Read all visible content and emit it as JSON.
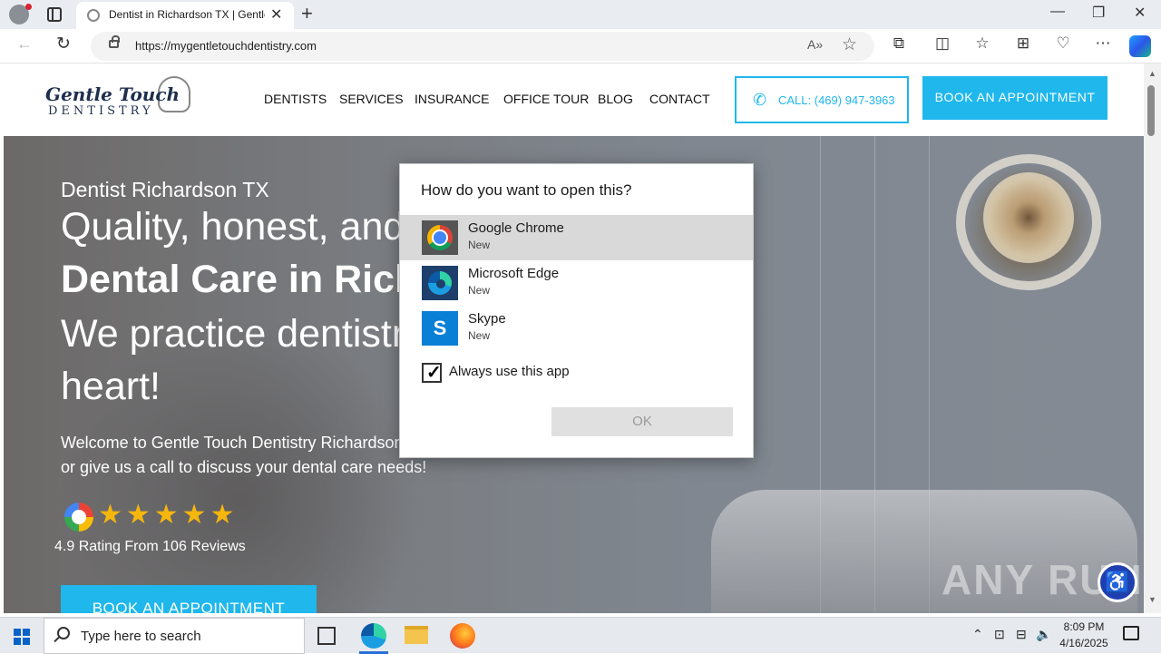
{
  "browser": {
    "tab_title": "Dentist in Richardson TX | Gentle Touch Dentistry",
    "url": "https://mygentletouchdentistry.com"
  },
  "site": {
    "logo_main": "Gentle Touch",
    "logo_sub": "DENTISTRY",
    "nav": [
      "DENTISTS",
      "SERVICES",
      "INSURANCE",
      "OFFICE TOUR",
      "BLOG",
      "CONTACT"
    ],
    "call_label": "CALL: (469) 947-3963",
    "book_label": "BOOK AN APPOINTMENT"
  },
  "hero": {
    "subtitle": "Dentist Richardson TX",
    "line1": "Quality, honest, and",
    "line2": "Dental Care in Richardson TX",
    "line3": "We practice dentistry with",
    "line4": "heart!",
    "welcome1": "Welcome to Gentle Touch Dentistry Richardson TX. Book online",
    "welcome2": "or give us a call to discuss your dental care needs!",
    "stars": "★★★★★",
    "star_count": 5,
    "rating_text": "4.9 Rating From 106 Reviews",
    "book_label": "BOOK AN APPOINTMENT"
  },
  "dialog": {
    "title": "How do you want to open this?",
    "apps": [
      {
        "name": "Google Chrome",
        "tag": "New",
        "icon": "chrome-icon",
        "selected": true
      },
      {
        "name": "Microsoft Edge",
        "tag": "New",
        "icon": "edge-icon",
        "selected": false
      },
      {
        "name": "Skype",
        "tag": "New",
        "icon": "skype-icon",
        "selected": false
      }
    ],
    "skype_letter": "S",
    "checkbox_label": "Always use this app",
    "checkbox_checked": true,
    "ok_label": "OK"
  },
  "watermark": "ANY RUN",
  "taskbar": {
    "search_placeholder": "Type here to search",
    "time": "8:09 PM",
    "date": "4/16/2025"
  },
  "colors": {
    "accent": "#1fb7ec",
    "logo_navy": "#1e2f4d",
    "star": "#f5b60d",
    "dialog_selected": "#d9d9d9"
  }
}
